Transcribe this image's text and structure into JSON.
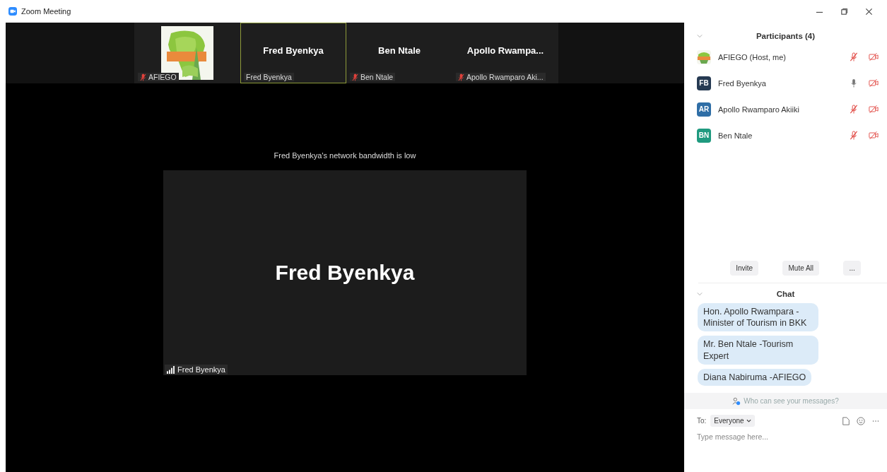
{
  "window": {
    "title": "Zoom Meeting"
  },
  "thumbnails": [
    {
      "kind": "picture",
      "label": "AFIEGO",
      "muted": true,
      "active_speaker": false
    },
    {
      "kind": "name",
      "display_name": "Fred Byenkya",
      "label": "Fred Byenkya",
      "muted": false,
      "active_speaker": true
    },
    {
      "kind": "name",
      "display_name": "Ben Ntale",
      "label": "Ben Ntale",
      "muted": true,
      "active_speaker": false
    },
    {
      "kind": "name",
      "display_name": "Apollo  Rwampa...",
      "label": "Apollo Rwamparo Aki...",
      "muted": true,
      "active_speaker": false
    }
  ],
  "notice": "Fred Byenkya's network bandwidth is low",
  "main_video": {
    "display_name": "Fred Byenkya",
    "label": "Fred Byenkya"
  },
  "participants": {
    "title": "Participants (4)",
    "items": [
      {
        "name": "AFIEGO (Host, me)",
        "kind": "picture",
        "muted": true,
        "video_off": true
      },
      {
        "name": "Fred Byenkya",
        "kind": "initials",
        "initials": "FB",
        "color": "#263a52",
        "muted": false,
        "video_off": true
      },
      {
        "name": "Apollo Rwamparo Akiiki",
        "kind": "initials",
        "initials": "AR",
        "color": "#2f6ea6",
        "muted": true,
        "video_off": true
      },
      {
        "name": "Ben Ntale",
        "kind": "initials",
        "initials": "BN",
        "color": "#1f9a7f",
        "muted": true,
        "video_off": true
      }
    ],
    "buttons": [
      "Invite",
      "Mute All",
      "..."
    ]
  },
  "chat": {
    "title": "Chat",
    "messages": [
      "Hon. Apollo Rwampara - Minister of Tourism in BKK",
      "Mr. Ben Ntale -Tourism Expert",
      "Diana Nabiruma -AFIEGO"
    ],
    "privacy_note": "Who can see your messages?",
    "to_label": "To:",
    "recipient": "Everyone",
    "placeholder": "Type message here..."
  }
}
